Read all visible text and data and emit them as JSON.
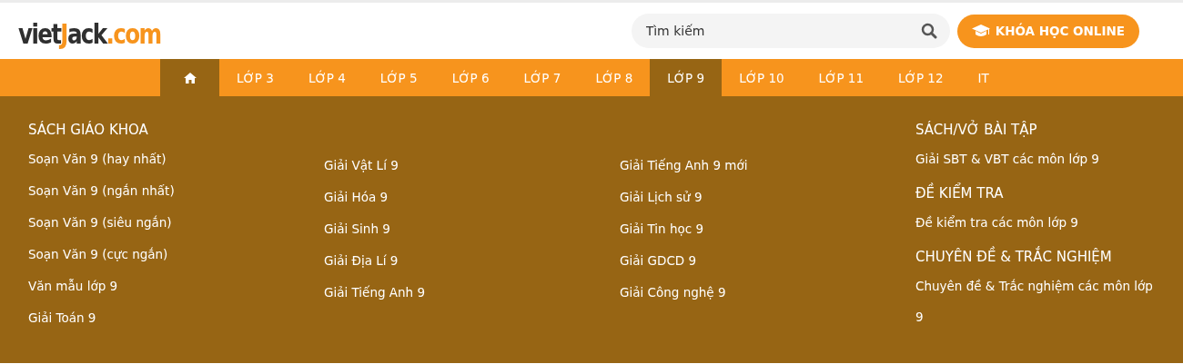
{
  "logo": [
    {
      "text": "viet",
      "accent": false
    },
    {
      "text": "J",
      "accent": true
    },
    {
      "text": "ack",
      "accent": false
    },
    {
      "text": ".com",
      "accent": true
    }
  ],
  "search": {
    "placeholder": "Tìm kiếm"
  },
  "course_button": {
    "label": "KHÓA HỌC ONLINE"
  },
  "nav": [
    {
      "kind": "home",
      "selected": true
    },
    {
      "label": "LỚP 3",
      "selected": false
    },
    {
      "label": "LỚP 4",
      "selected": false
    },
    {
      "label": "LỚP 5",
      "selected": false
    },
    {
      "label": "LỚP 6",
      "selected": false
    },
    {
      "label": "LỚP 7",
      "selected": false
    },
    {
      "label": "LỚP 8",
      "selected": false
    },
    {
      "label": "LỚP 9",
      "selected": true
    },
    {
      "label": "LỚP 10",
      "selected": false
    },
    {
      "label": "LỚP 11",
      "selected": false
    },
    {
      "label": "LỚP 12",
      "selected": false
    },
    {
      "label": "IT",
      "selected": false
    }
  ],
  "menu_columns": [
    {
      "sections": [
        {
          "heading": "SÁCH GIÁO KHOA",
          "items": [
            "Soạn Văn 9 (hay nhất)",
            "Soạn Văn 9 (ngắn nhất)",
            "Soạn Văn 9 (siêu ngắn)",
            "Soạn Văn 9 (cực ngắn)",
            "Văn mẫu lớp 9",
            "Giải Toán 9"
          ]
        }
      ]
    },
    {
      "sections": [
        {
          "items": [
            "Giải Vật Lí 9",
            "Giải Hóa 9",
            "Giải Sinh 9",
            "Giải Địa Lí 9",
            "Giải Tiếng Anh 9"
          ]
        }
      ]
    },
    {
      "sections": [
        {
          "items": [
            "Giải Tiếng Anh 9 mới",
            "Giải Lịch sử 9",
            "Giải Tin học 9",
            "Giải GDCD 9",
            "Giải Công nghệ 9"
          ]
        }
      ]
    },
    {
      "sections": [
        {
          "heading": "SÁCH/VỞ BÀI TẬP",
          "items": [
            "Giải SBT & VBT các môn lớp 9"
          ]
        },
        {
          "heading": "ĐỀ KIỂM TRA",
          "items": [
            "Đề kiểm tra các môn lớp 9"
          ]
        },
        {
          "heading": "CHUYÊN ĐỀ & TRẮC NGHIỆM",
          "items": [
            "Chuyên đề & Trắc nghiệm các môn lớp 9"
          ]
        }
      ]
    }
  ]
}
